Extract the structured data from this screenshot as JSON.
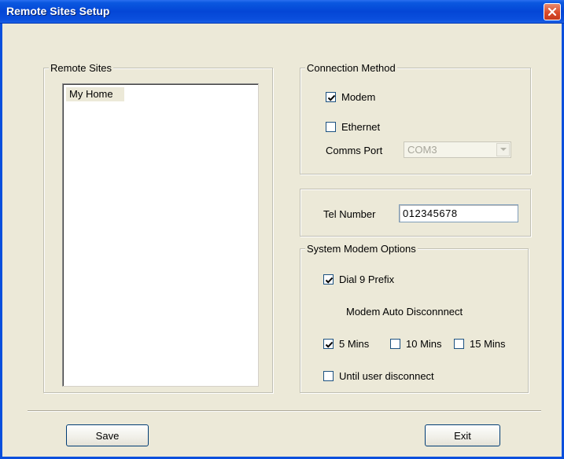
{
  "window": {
    "title": "Remote Sites Setup"
  },
  "remote_sites": {
    "legend": "Remote Sites",
    "items": [
      "My Home"
    ]
  },
  "connection_method": {
    "legend": "Connection Method",
    "modem_label": "Modem",
    "modem_checked": true,
    "ethernet_label": "Ethernet",
    "ethernet_checked": false,
    "comms_port_label": "Comms Port",
    "comms_port_value": "COM3"
  },
  "tel": {
    "label": "Tel  Number",
    "value": "012345678"
  },
  "system_modem_options": {
    "legend": "System Modem Options",
    "dial9_label": "Dial 9 Prefix",
    "dial9_checked": true,
    "auto_disconnect_label": "Modem Auto Disconnnect",
    "mins5_label": "5 Mins",
    "mins5_checked": true,
    "mins10_label": "10 Mins",
    "mins10_checked": false,
    "mins15_label": "15 Mins",
    "mins15_checked": false,
    "until_user_label": "Until user disconnect",
    "until_user_checked": false
  },
  "buttons": {
    "save": "Save",
    "exit": "Exit"
  },
  "colors": {
    "titlebar": "#0a4fdd",
    "dialog_bg": "#ece9d8",
    "close_button": "#d94b2a"
  },
  "icons": {
    "close": "close-icon",
    "dropdown": "chevron-down-icon",
    "check": "checkmark-icon"
  }
}
